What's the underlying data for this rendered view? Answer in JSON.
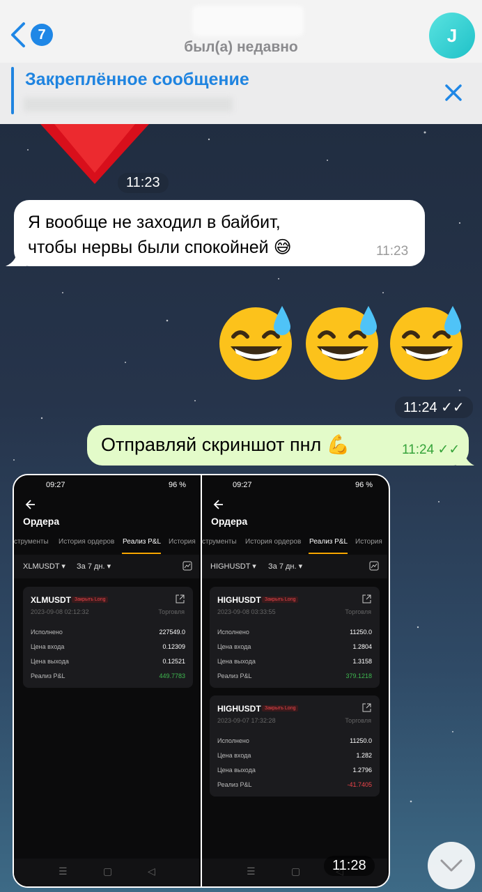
{
  "header": {
    "unread_count": "7",
    "status": "был(а) недавно",
    "avatar_letter": "J"
  },
  "pinned": {
    "title": "Закреплённое сообщение"
  },
  "messages": {
    "m1_time": "11:23",
    "m2_text_line1": "Я вообще не заходил в байбит,",
    "m2_text_line2": "чтобы нервы были спокойней 😅",
    "m2_time": "11:23",
    "emoji_time": "11:24",
    "m3_text": "Отправляй скриншот пнл 💪",
    "m3_time": "11:24",
    "screens_time": "11:28"
  },
  "screens": [
    {
      "clock": "09:27",
      "battery": "96 %",
      "title": "Ордера",
      "tabs": [
        "струменты",
        "История ордеров",
        "Реализ P&L",
        "История"
      ],
      "filter_symbol": "XLMUSDT ▾",
      "filter_period": "За 7 дн. ▾",
      "cards": [
        {
          "symbol": "XLMUSDT",
          "tag": "Закрыть Long",
          "date": "2023-09-08 02:12:32",
          "kind": "Торговля",
          "rows": [
            {
              "label": "Исполнено",
              "value": "227549.0"
            },
            {
              "label": "Цена входа",
              "value": "0.12309"
            },
            {
              "label": "Цена выхода",
              "value": "0.12521"
            },
            {
              "label": "Реализ P&L",
              "value": "449.7783"
            }
          ]
        }
      ]
    },
    {
      "clock": "09:27",
      "battery": "96 %",
      "title": "Ордера",
      "tabs": [
        "струменты",
        "История ордеров",
        "Реализ P&L",
        "История"
      ],
      "filter_symbol": "HIGHUSDT ▾",
      "filter_period": "За 7 дн. ▾",
      "cards": [
        {
          "symbol": "HIGHUSDT",
          "tag": "Закрыть Long",
          "date": "2023-09-08 03:33:55",
          "kind": "Торговля",
          "rows": [
            {
              "label": "Исполнено",
              "value": "11250.0"
            },
            {
              "label": "Цена входа",
              "value": "1.2804"
            },
            {
              "label": "Цена выхода",
              "value": "1.3158"
            },
            {
              "label": "Реализ P&L",
              "value": "379.1218"
            }
          ]
        },
        {
          "symbol": "HIGHUSDT",
          "tag": "Закрыть Long",
          "date": "2023-09-07 17:32:28",
          "kind": "Торговля",
          "rows": [
            {
              "label": "Исполнено",
              "value": "11250.0"
            },
            {
              "label": "Цена входа",
              "value": "1.282"
            },
            {
              "label": "Цена выхода",
              "value": "1.2796"
            },
            {
              "label": "Реализ P&L",
              "value": "-41.7405"
            }
          ]
        }
      ]
    }
  ],
  "colors": {
    "accent": "#1f87e6",
    "outgoing_bubble": "#e3fbc9",
    "pnl_positive": "#3fb950",
    "pnl_negative": "#ef454a"
  }
}
